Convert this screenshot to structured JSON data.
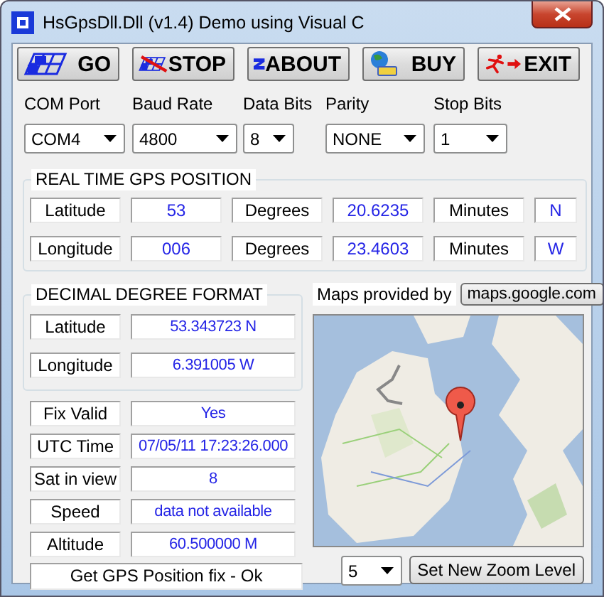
{
  "window": {
    "title": "HsGpsDll.Dll (v1.4) Demo using Visual C"
  },
  "toolbar": [
    {
      "kind": "go",
      "label": "GO"
    },
    {
      "kind": "stop",
      "label": "STOP"
    },
    {
      "kind": "about",
      "label": "ABOUT"
    },
    {
      "kind": "buy",
      "label": "BUY"
    },
    {
      "kind": "exit",
      "label": "EXIT"
    }
  ],
  "serial_settings": [
    {
      "label": "COM Port",
      "value": "COM4"
    },
    {
      "label": "Baud Rate",
      "value": "4800"
    },
    {
      "label": "Data Bits",
      "value": "8"
    },
    {
      "label": "Parity",
      "value": "NONE"
    },
    {
      "label": "Stop Bits",
      "value": "1"
    }
  ],
  "realtime_position": {
    "title": "REAL TIME GPS POSITION",
    "rows": [
      {
        "label": "Latitude",
        "degrees": "53",
        "degrees_label": "Degrees",
        "minutes": "20.6235",
        "minutes_label": "Minutes",
        "hemisphere": "N"
      },
      {
        "label": "Longitude",
        "degrees": "006",
        "degrees_label": "Degrees",
        "minutes": "23.4603",
        "minutes_label": "Minutes",
        "hemisphere": "W"
      }
    ]
  },
  "decimal_degree_format": {
    "title": "DECIMAL DEGREE FORMAT",
    "rows": [
      {
        "label": "Latitude",
        "value": "53.343723 N"
      },
      {
        "label": "Longitude",
        "value": "6.391005 W"
      }
    ]
  },
  "status_fields": [
    {
      "label": "Fix Valid",
      "value": "Yes"
    },
    {
      "label": "UTC Time",
      "value": "07/05/11 17:23:26.000"
    },
    {
      "label": "Sat in view",
      "value": "8"
    },
    {
      "label": "Speed",
      "value": "data not available"
    },
    {
      "label": "Altitude",
      "value": "60.500000 M"
    }
  ],
  "status_message": "Get GPS Position fix - Ok",
  "map": {
    "credit_label": "Maps provided by",
    "credit_link": "maps.google.com",
    "kind": "picture",
    "zoom_level": "5",
    "zoom_button": "Set New Zoom Level"
  }
}
